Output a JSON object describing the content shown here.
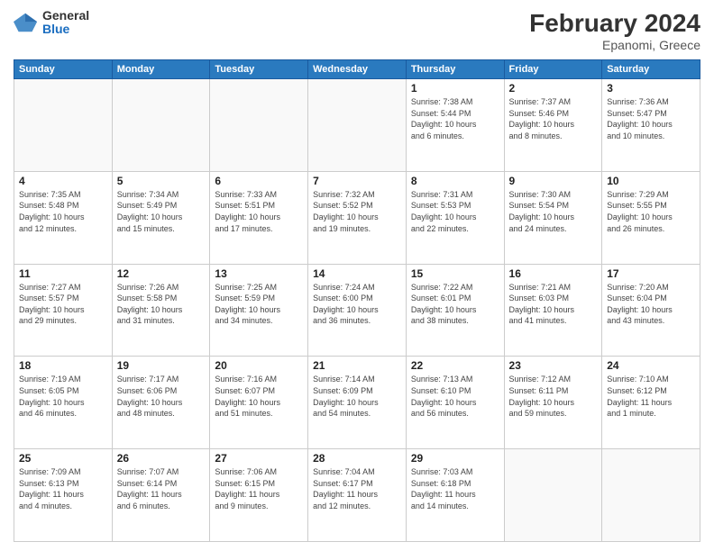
{
  "logo": {
    "general": "General",
    "blue": "Blue"
  },
  "title": "February 2024",
  "subtitle": "Epanomi, Greece",
  "days_of_week": [
    "Sunday",
    "Monday",
    "Tuesday",
    "Wednesday",
    "Thursday",
    "Friday",
    "Saturday"
  ],
  "weeks": [
    [
      {
        "day": "",
        "info": ""
      },
      {
        "day": "",
        "info": ""
      },
      {
        "day": "",
        "info": ""
      },
      {
        "day": "",
        "info": ""
      },
      {
        "day": "1",
        "info": "Sunrise: 7:38 AM\nSunset: 5:44 PM\nDaylight: 10 hours\nand 6 minutes."
      },
      {
        "day": "2",
        "info": "Sunrise: 7:37 AM\nSunset: 5:46 PM\nDaylight: 10 hours\nand 8 minutes."
      },
      {
        "day": "3",
        "info": "Sunrise: 7:36 AM\nSunset: 5:47 PM\nDaylight: 10 hours\nand 10 minutes."
      }
    ],
    [
      {
        "day": "4",
        "info": "Sunrise: 7:35 AM\nSunset: 5:48 PM\nDaylight: 10 hours\nand 12 minutes."
      },
      {
        "day": "5",
        "info": "Sunrise: 7:34 AM\nSunset: 5:49 PM\nDaylight: 10 hours\nand 15 minutes."
      },
      {
        "day": "6",
        "info": "Sunrise: 7:33 AM\nSunset: 5:51 PM\nDaylight: 10 hours\nand 17 minutes."
      },
      {
        "day": "7",
        "info": "Sunrise: 7:32 AM\nSunset: 5:52 PM\nDaylight: 10 hours\nand 19 minutes."
      },
      {
        "day": "8",
        "info": "Sunrise: 7:31 AM\nSunset: 5:53 PM\nDaylight: 10 hours\nand 22 minutes."
      },
      {
        "day": "9",
        "info": "Sunrise: 7:30 AM\nSunset: 5:54 PM\nDaylight: 10 hours\nand 24 minutes."
      },
      {
        "day": "10",
        "info": "Sunrise: 7:29 AM\nSunset: 5:55 PM\nDaylight: 10 hours\nand 26 minutes."
      }
    ],
    [
      {
        "day": "11",
        "info": "Sunrise: 7:27 AM\nSunset: 5:57 PM\nDaylight: 10 hours\nand 29 minutes."
      },
      {
        "day": "12",
        "info": "Sunrise: 7:26 AM\nSunset: 5:58 PM\nDaylight: 10 hours\nand 31 minutes."
      },
      {
        "day": "13",
        "info": "Sunrise: 7:25 AM\nSunset: 5:59 PM\nDaylight: 10 hours\nand 34 minutes."
      },
      {
        "day": "14",
        "info": "Sunrise: 7:24 AM\nSunset: 6:00 PM\nDaylight: 10 hours\nand 36 minutes."
      },
      {
        "day": "15",
        "info": "Sunrise: 7:22 AM\nSunset: 6:01 PM\nDaylight: 10 hours\nand 38 minutes."
      },
      {
        "day": "16",
        "info": "Sunrise: 7:21 AM\nSunset: 6:03 PM\nDaylight: 10 hours\nand 41 minutes."
      },
      {
        "day": "17",
        "info": "Sunrise: 7:20 AM\nSunset: 6:04 PM\nDaylight: 10 hours\nand 43 minutes."
      }
    ],
    [
      {
        "day": "18",
        "info": "Sunrise: 7:19 AM\nSunset: 6:05 PM\nDaylight: 10 hours\nand 46 minutes."
      },
      {
        "day": "19",
        "info": "Sunrise: 7:17 AM\nSunset: 6:06 PM\nDaylight: 10 hours\nand 48 minutes."
      },
      {
        "day": "20",
        "info": "Sunrise: 7:16 AM\nSunset: 6:07 PM\nDaylight: 10 hours\nand 51 minutes."
      },
      {
        "day": "21",
        "info": "Sunrise: 7:14 AM\nSunset: 6:09 PM\nDaylight: 10 hours\nand 54 minutes."
      },
      {
        "day": "22",
        "info": "Sunrise: 7:13 AM\nSunset: 6:10 PM\nDaylight: 10 hours\nand 56 minutes."
      },
      {
        "day": "23",
        "info": "Sunrise: 7:12 AM\nSunset: 6:11 PM\nDaylight: 10 hours\nand 59 minutes."
      },
      {
        "day": "24",
        "info": "Sunrise: 7:10 AM\nSunset: 6:12 PM\nDaylight: 11 hours\nand 1 minute."
      }
    ],
    [
      {
        "day": "25",
        "info": "Sunrise: 7:09 AM\nSunset: 6:13 PM\nDaylight: 11 hours\nand 4 minutes."
      },
      {
        "day": "26",
        "info": "Sunrise: 7:07 AM\nSunset: 6:14 PM\nDaylight: 11 hours\nand 6 minutes."
      },
      {
        "day": "27",
        "info": "Sunrise: 7:06 AM\nSunset: 6:15 PM\nDaylight: 11 hours\nand 9 minutes."
      },
      {
        "day": "28",
        "info": "Sunrise: 7:04 AM\nSunset: 6:17 PM\nDaylight: 11 hours\nand 12 minutes."
      },
      {
        "day": "29",
        "info": "Sunrise: 7:03 AM\nSunset: 6:18 PM\nDaylight: 11 hours\nand 14 minutes."
      },
      {
        "day": "",
        "info": ""
      },
      {
        "day": "",
        "info": ""
      }
    ]
  ]
}
